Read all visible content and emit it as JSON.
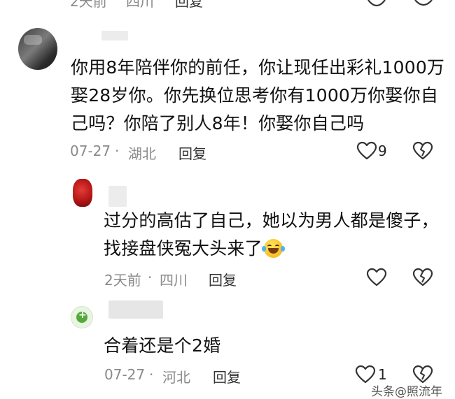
{
  "top_strip": {
    "time": "2天前",
    "location": "四川",
    "reply_label": "回复"
  },
  "main_comment": {
    "avatar_icon": "user-avatar-icon",
    "lines": [
      "你用8年陪伴你的前任，你让现任出彩礼1000万",
      "娶28岁你。你先换位思考你有1000万你娶你自",
      "己吗？你陪了别人8年！你娶你自己吗"
    ],
    "date": "07-27",
    "separator": "·",
    "location": "湖北",
    "reply_label": "回复",
    "like_count": "9"
  },
  "replies": [
    {
      "lines": [
        "过分的高估了自己，她以为男人都是傻子，",
        "找接盘侠冤大头来了"
      ],
      "emoji": "laughing-tears-emoji",
      "time": "2天前",
      "separator": "·",
      "location": "四川",
      "reply_label": "回复"
    },
    {
      "lines": [
        "合着还是个2婚"
      ],
      "time": "07-27",
      "separator": "·",
      "location": "河北",
      "reply_label": "回复",
      "like_count": "1"
    }
  ],
  "watermark": "头条@照流年",
  "colors": {
    "text": "#111111",
    "meta": "#8a8a8a",
    "icon_stroke": "#333333"
  }
}
